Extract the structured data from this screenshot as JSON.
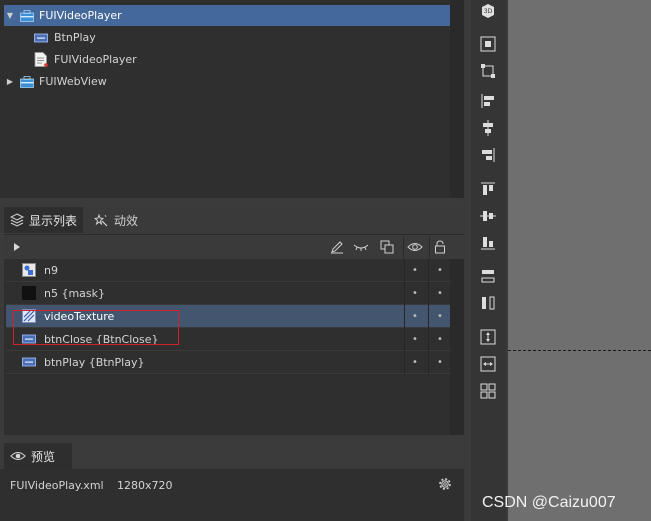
{
  "tree": {
    "items": [
      {
        "label": "FUIVideoPlayer",
        "icon": "package-icon",
        "expanded": true,
        "selected": true
      },
      {
        "label": "BtnPlay",
        "icon": "button-component-icon"
      },
      {
        "label": "FUIVideoPlayer",
        "icon": "component-file-icon"
      },
      {
        "label": "FUIWebView",
        "icon": "package-icon",
        "expanded": false
      }
    ]
  },
  "tabs": [
    {
      "label": "显示列表",
      "icon": "layers-icon",
      "active": true
    },
    {
      "label": "动效",
      "icon": "effects-icon",
      "active": false
    }
  ],
  "display_list": [
    {
      "label": "n9",
      "icon": "graph-icon"
    },
    {
      "label": "n5 {mask}",
      "icon": "black-square-icon"
    },
    {
      "label": "videoTexture",
      "icon": "texture-icon",
      "selected": true
    },
    {
      "label": "btnClose {BtnClose}",
      "icon": "button-component-icon"
    },
    {
      "label": "btnPlay {BtnPlay}",
      "icon": "button-component-icon"
    }
  ],
  "preview": {
    "tab_label": "预览",
    "file": "FUIVideoPlay.xml",
    "size": "1280x720"
  },
  "watermark": "CSDN @Caizu007",
  "colors": {
    "selection_tree": "#44689a",
    "selection_list": "#43556f",
    "highlight_box": "#d0232a"
  }
}
